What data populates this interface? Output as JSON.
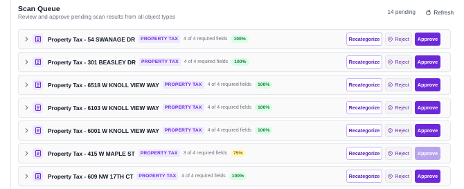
{
  "header": {
    "title": "Scan Queue",
    "subtitle": "Review and approve pending scan results from all object types",
    "pending": "14 pending",
    "refresh_label": "Refresh"
  },
  "rows": [
    {
      "name": "Property Tax - 54 SWANAGE DR",
      "tag": "PROPERTY TAX",
      "fields": "4 of 4 required fields",
      "percent": "100%",
      "approve_enabled": true
    },
    {
      "name": "Property Tax - 301 BEASLEY DR",
      "tag": "PROPERTY TAX",
      "fields": "4 of 4 required fields",
      "percent": "100%",
      "approve_enabled": true
    },
    {
      "name": "Property Tax - 6518 W KNOLL VIEW WAY",
      "tag": "PROPERTY TAX",
      "fields": "4 of 4 required fields",
      "percent": "100%",
      "approve_enabled": true
    },
    {
      "name": "Property Tax - 6103 W KNOLL VIEW WAY",
      "tag": "PROPERTY TAX",
      "fields": "4 of 4 required fields",
      "percent": "100%",
      "approve_enabled": true
    },
    {
      "name": "Property Tax - 6001 W KNOLL VIEW WAY",
      "tag": "PROPERTY TAX",
      "fields": "4 of 4 required fields",
      "percent": "100%",
      "approve_enabled": true
    },
    {
      "name": "Property Tax - 415 W MAPLE ST",
      "tag": "PROPERTY TAX",
      "fields": "3 of 4 required fields",
      "percent": "75%",
      "approve_enabled": false
    },
    {
      "name": "Property Tax - 609 NW 17TH CT",
      "tag": "PROPERTY TAX",
      "fields": "4 of 4 required fields",
      "percent": "100%",
      "approve_enabled": true
    }
  ],
  "actions": {
    "recategorize_label": "Recategorize",
    "reject_label": "Reject",
    "approve_label": "Approve"
  },
  "colors": {
    "accent": "#6d28d9",
    "accent_disabled": "#b8a3ee",
    "complete_badge": "#dcfce7",
    "partial_badge": "#fef9c3"
  }
}
